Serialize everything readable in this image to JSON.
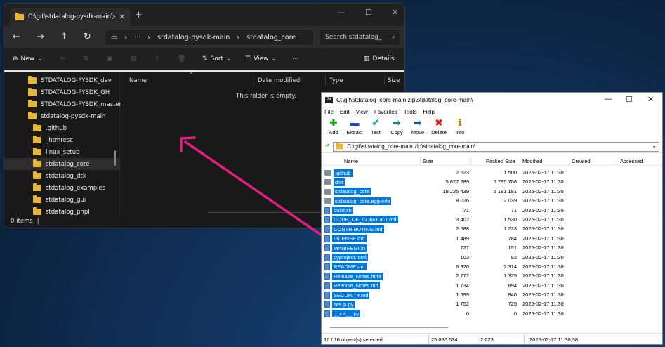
{
  "explorer": {
    "tab_title": "C:\\git\\stdatalog-pysdk-main\\s",
    "address": [
      "stdatalog-pysdk-main",
      "stdatalog_core"
    ],
    "search_placeholder": "Search stdatalog_",
    "toolbar": {
      "new": "New",
      "sort": "Sort",
      "view": "View",
      "details": "Details"
    },
    "nav_items": [
      {
        "label": "STDATALOG-PYSDK_dev",
        "indent": 1
      },
      {
        "label": "STDATALOG-PYSDK_GH",
        "indent": 1
      },
      {
        "label": "STDATALOG-PYSDK_master",
        "indent": 1
      },
      {
        "label": "stdatalog-pysdk-main",
        "indent": 1
      },
      {
        "label": ".github",
        "indent": 2
      },
      {
        "label": "_htmresc",
        "indent": 2
      },
      {
        "label": "linux_setup",
        "indent": 2
      },
      {
        "label": "stdatalog_core",
        "indent": 2,
        "selected": true
      },
      {
        "label": "stdatalog_dtk",
        "indent": 2
      },
      {
        "label": "stdatalog_examples",
        "indent": 2
      },
      {
        "label": "stdatalog_gui",
        "indent": 2
      },
      {
        "label": "stdatalog_pnpl",
        "indent": 2
      }
    ],
    "columns": {
      "name": "Name",
      "date": "Date modified",
      "type": "Type",
      "size": "Size"
    },
    "empty_message": "This folder is empty.",
    "status": "0 items"
  },
  "sevenzip": {
    "title": "C:\\git\\stdatalog_core-main.zip\\stdatalog_core-main\\",
    "menu": [
      "File",
      "Edit",
      "View",
      "Favorites",
      "Tools",
      "Help"
    ],
    "toolbar": [
      {
        "label": "Add",
        "glyph": "✚",
        "color": "#1aa31a"
      },
      {
        "label": "Extract",
        "glyph": "▬",
        "color": "#1a3fd1"
      },
      {
        "label": "Test",
        "glyph": "✔",
        "color": "#1aa3a3"
      },
      {
        "label": "Copy",
        "glyph": "➡",
        "color": "#1a8a8a"
      },
      {
        "label": "Move",
        "glyph": "➡",
        "color": "#1a5aa0"
      },
      {
        "label": "Delete",
        "glyph": "✖",
        "color": "#d11a1a"
      },
      {
        "label": "Info",
        "glyph": "ℹ",
        "color": "#b08a00"
      }
    ],
    "path": "C:\\git\\stdatalog_core-main.zip\\stdatalog_core-main\\",
    "columns": {
      "name": "Name",
      "size": "Size",
      "packed": "Packed Size",
      "modified": "Modified",
      "created": "Created",
      "accessed": "Accessed"
    },
    "rows": [
      {
        "name": ".github",
        "type": "folder",
        "size": "2 623",
        "packed": "1 500",
        "modified": "2025-02-17 11:30"
      },
      {
        "name": "dist",
        "type": "folder",
        "size": "5 827 289",
        "packed": "5 785 708",
        "modified": "2025-02-17 11:30"
      },
      {
        "name": "stdatalog_core",
        "type": "folder",
        "size": "19 225 439",
        "packed": "5 181 181",
        "modified": "2025-02-17 11:30"
      },
      {
        "name": "stdatalog_core.egg-info",
        "type": "folder",
        "size": "8 026",
        "packed": "2 039",
        "modified": "2025-02-17 11:30"
      },
      {
        "name": "build.sh",
        "type": "file",
        "size": "71",
        "packed": "71",
        "modified": "2025-02-17 11:30"
      },
      {
        "name": "CODE_OF_CONDUCT.md",
        "type": "file",
        "size": "3 402",
        "packed": "1 530",
        "modified": "2025-02-17 11:30"
      },
      {
        "name": "CONTRIBUTING.md",
        "type": "file",
        "size": "2 588",
        "packed": "1 233",
        "modified": "2025-02-17 11:30"
      },
      {
        "name": "LICENSE.md",
        "type": "file",
        "size": "1 489",
        "packed": "784",
        "modified": "2025-02-17 11:30"
      },
      {
        "name": "MANIFEST.in",
        "type": "file",
        "size": "727",
        "packed": "151",
        "modified": "2025-02-17 11:30"
      },
      {
        "name": "pyproject.toml",
        "type": "file",
        "size": "103",
        "packed": "82",
        "modified": "2025-02-17 11:30"
      },
      {
        "name": "README.md",
        "type": "file",
        "size": "6 920",
        "packed": "2 314",
        "modified": "2025-02-17 11:30"
      },
      {
        "name": "Release_Notes.html",
        "type": "file",
        "size": "2 772",
        "packed": "1 325",
        "modified": "2025-02-17 11:30"
      },
      {
        "name": "Release_Notes.md",
        "type": "file",
        "size": "1 734",
        "packed": "894",
        "modified": "2025-02-17 11:30"
      },
      {
        "name": "SECURITY.md",
        "type": "file",
        "size": "1 699",
        "packed": "840",
        "modified": "2025-02-17 11:30"
      },
      {
        "name": "setup.py",
        "type": "file",
        "size": "1 752",
        "packed": "725",
        "modified": "2025-02-17 11:30"
      },
      {
        "name": "__init__.py",
        "type": "file",
        "size": "0",
        "packed": "0",
        "modified": "2025-02-17 11:30"
      }
    ],
    "status": {
      "count": "16 / 16 object(s) selected",
      "size": "25 086 634",
      "packed": "2 623",
      "date": "2025-02-17 11:30:38"
    }
  }
}
